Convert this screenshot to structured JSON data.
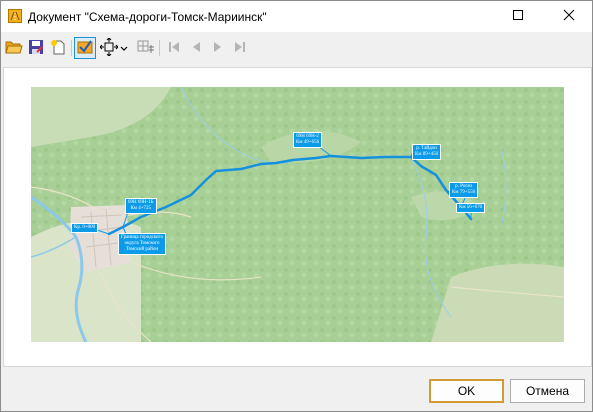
{
  "window": {
    "title": "Документ \"Схема-дороги-Томск-Мариинск\""
  },
  "toolbar": {
    "buttons": [
      {
        "icon": "open-folder-icon"
      },
      {
        "icon": "save-icon"
      },
      {
        "icon": "new-document-icon"
      },
      {
        "icon": "apply-check-icon"
      },
      {
        "icon": "fit-extent-icon"
      },
      {
        "icon": "chevron-down-icon"
      },
      {
        "icon": "grid-tool-icon"
      },
      {
        "icon": "first-icon"
      },
      {
        "icon": "previous-icon"
      },
      {
        "icon": "next-icon"
      },
      {
        "icon": "last-icon"
      }
    ]
  },
  "map": {
    "labels": [
      {
        "id": "start",
        "lines": [
          "Кр. 0+000"
        ]
      },
      {
        "id": "border",
        "lines": [
          "Граница городского",
          "округа Томского",
          "Томский район"
        ]
      },
      {
        "id": "road1",
        "lines": [
          "69Н 69Н-1Б",
          "Км 4+725"
        ]
      },
      {
        "id": "road2",
        "lines": [
          "69Н 69Н-2",
          "Км 49+656"
        ]
      },
      {
        "id": "river1",
        "lines": [
          "р. Тайдон",
          "Км 89+450"
        ]
      },
      {
        "id": "river2",
        "lines": [
          "р. Рогач",
          "Км 79+550"
        ]
      },
      {
        "id": "end",
        "lines": [
          "Км 56+670"
        ]
      }
    ],
    "colors": {
      "route": "#1591dd",
      "label_bg": "#0b9be8"
    }
  },
  "footer": {
    "ok_label": "OK",
    "cancel_label": "Отмена"
  }
}
